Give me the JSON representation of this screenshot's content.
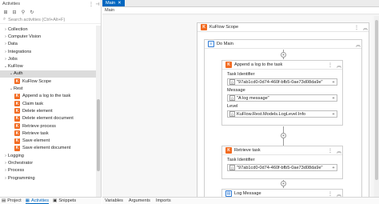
{
  "activities_panel": {
    "title": "Activities",
    "search_placeholder": "Search activities (Ctrl+Alt+F)",
    "tree": [
      {
        "label": "Collection",
        "level": 1,
        "expanded": false
      },
      {
        "label": "Computer Vision",
        "level": 1,
        "expanded": false
      },
      {
        "label": "Data",
        "level": 1,
        "expanded": false
      },
      {
        "label": "Integrations",
        "level": 1,
        "expanded": false
      },
      {
        "label": "Jobs",
        "level": 1,
        "expanded": false
      },
      {
        "label": "KuFlow",
        "level": 1,
        "expanded": true
      },
      {
        "label": "Auth",
        "level": 2,
        "expanded": true,
        "selected": true
      },
      {
        "label": "KuFlow Scope",
        "level": 3,
        "leaf": true
      },
      {
        "label": "Rest",
        "level": 2,
        "expanded": true
      },
      {
        "label": "Append a log to the task",
        "level": 3,
        "leaf": true
      },
      {
        "label": "Claim task",
        "level": 3,
        "leaf": true
      },
      {
        "label": "Delete element",
        "level": 3,
        "leaf": true
      },
      {
        "label": "Delete element document",
        "level": 3,
        "leaf": true
      },
      {
        "label": "Retrieve process",
        "level": 3,
        "leaf": true
      },
      {
        "label": "Retrieve task",
        "level": 3,
        "leaf": true
      },
      {
        "label": "Save element",
        "level": 3,
        "leaf": true
      },
      {
        "label": "Save element document",
        "level": 3,
        "leaf": true
      },
      {
        "label": "Logging",
        "level": 1,
        "expanded": false
      },
      {
        "label": "Orchestrator",
        "level": 1,
        "expanded": false
      },
      {
        "label": "Process",
        "level": 1,
        "expanded": false
      },
      {
        "label": "Programming",
        "level": 1,
        "expanded": false
      }
    ],
    "bottom_tabs": [
      "Project",
      "Activities",
      "Snippets"
    ]
  },
  "designer": {
    "tab_label": "Main",
    "breadcrumb": "Main",
    "scope_title": "KuFlow Scope",
    "sequence_title": "Do Main",
    "append_log": {
      "title": "Append a log to the task",
      "task_identifier_label": "Task Identifier",
      "task_identifier_value": "\"97ab1cd0-0d74-460f-bfb5-0ae73d08da9e\"",
      "message_label": "Message",
      "message_value": "\"A log message\"",
      "level_label": "Level",
      "level_value": "KuFlow.Rest.Models.LogLevel.Info"
    },
    "retrieve_task": {
      "title": "Retrieve task",
      "task_identifier_label": "Task Identifier",
      "task_identifier_value": "\"97ab1cd0-0d74-460f-bfb5-0ae73d08da9e\""
    },
    "log_message": {
      "title": "Log Message"
    },
    "bottom_tabs": [
      "Variables",
      "Arguments",
      "Imports"
    ]
  },
  "colors": {
    "accent": "#0067c0",
    "kuflow": "#f26b21"
  }
}
